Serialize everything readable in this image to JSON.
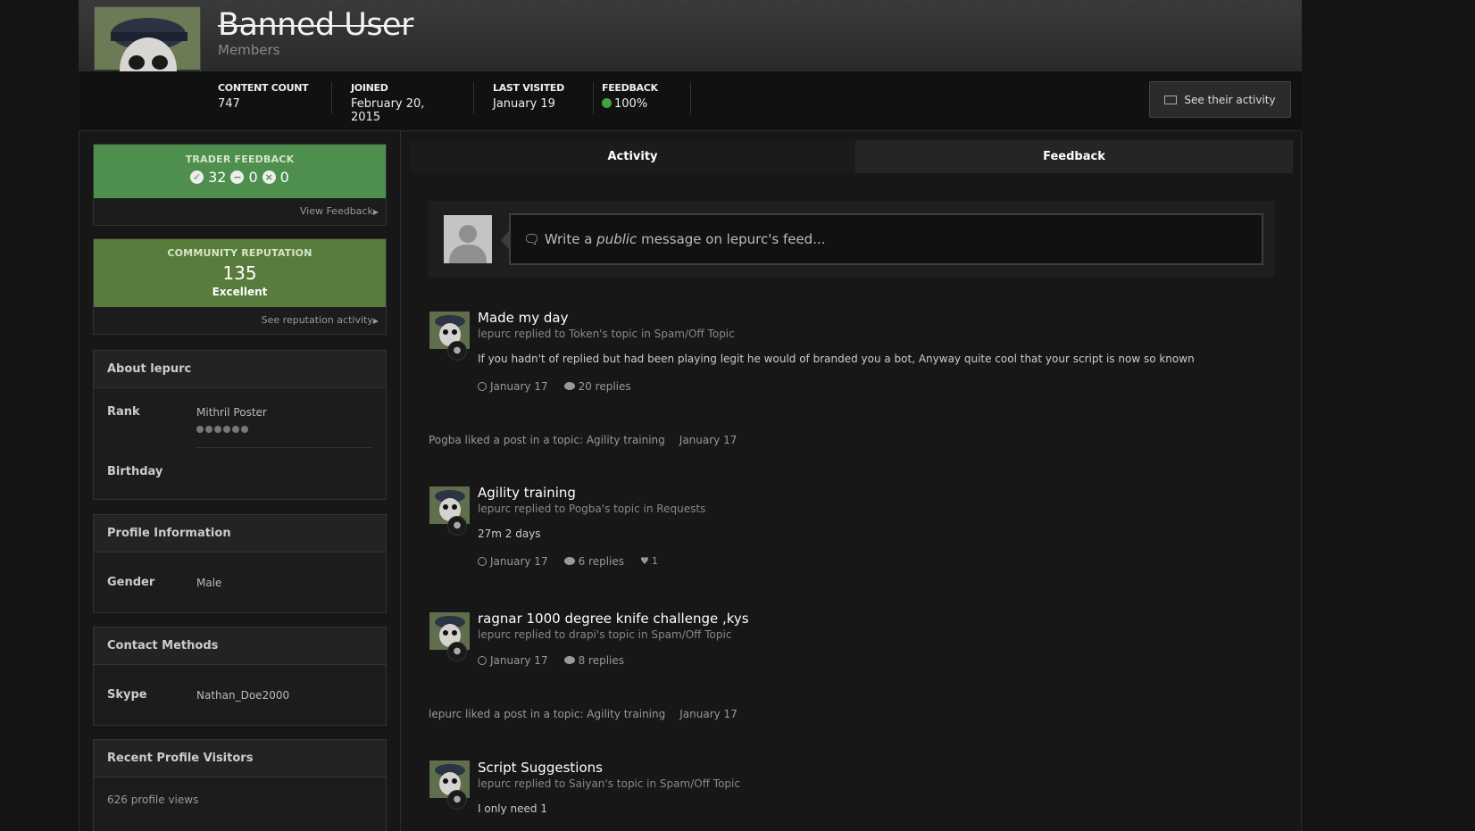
{
  "header": {
    "user_name": "Banned User",
    "user_group": "Members"
  },
  "stats": {
    "content_count_label": "CONTENT COUNT",
    "content_count": "747",
    "joined_label": "JOINED",
    "joined": "February 20, 2015",
    "last_visited_label": "LAST VISITED",
    "last_visited": "January 19",
    "feedback_label": "FEEDBACK",
    "feedback": "100%"
  },
  "activity_button": "See their activity",
  "sidebar": {
    "trader": {
      "title": "TRADER FEEDBACK",
      "positive": "32",
      "neutral": "0",
      "negative": "0",
      "link": "View Feedback"
    },
    "reputation": {
      "title": "COMMUNITY REPUTATION",
      "value": "135",
      "word": "Excellent",
      "link": "See reputation activity"
    },
    "about": {
      "title": "About lepurc",
      "rank_key": "Rank",
      "rank_value": "Mithril Poster",
      "birthday_key": "Birthday"
    },
    "profile": {
      "title": "Profile Information",
      "gender_key": "Gender",
      "gender_value": "Male"
    },
    "contact": {
      "title": "Contact Methods",
      "skype_key": "Skype",
      "skype_value": "Nathan_Doe2000"
    },
    "visitors": {
      "title": "Recent Profile Visitors",
      "views": "626 profile views"
    }
  },
  "tabs": {
    "activity": "Activity",
    "feedback": "Feedback"
  },
  "composer": {
    "prefix": "Write a",
    "emphasis": "public",
    "suffix": "message on lepurc's feed..."
  },
  "feed": {
    "item1": {
      "title": "Made my day",
      "meta": "lepurc replied to Token's topic in Spam/Off Topic",
      "body": "If you hadn't of replied but had been playing legit he would of branded you a bot, Anyway quite cool that your script is now so known",
      "date": "January 17",
      "replies": "20 replies"
    },
    "like1": {
      "text": "Pogba liked a post in a topic: Agility training",
      "date": "January 17"
    },
    "item2": {
      "title": "Agility training",
      "meta": "lepurc replied to Pogba's topic in Requests",
      "body": "27m 2 days",
      "date": "January 17",
      "replies": "6 replies",
      "likes": "1"
    },
    "item3": {
      "title": "ragnar 1000 degree knife challenge ,kys",
      "meta": "lepurc replied to drapi's topic in Spam/Off Topic",
      "date": "January 17",
      "replies": "8 replies"
    },
    "like2": {
      "text": "lepurc liked a post in a topic: Agility training",
      "date": "January 17"
    },
    "item4": {
      "title": "Script Suggestions",
      "meta": "lepurc replied to Saiyan's topic in Spam/Off Topic",
      "body": "I only need 1"
    }
  }
}
